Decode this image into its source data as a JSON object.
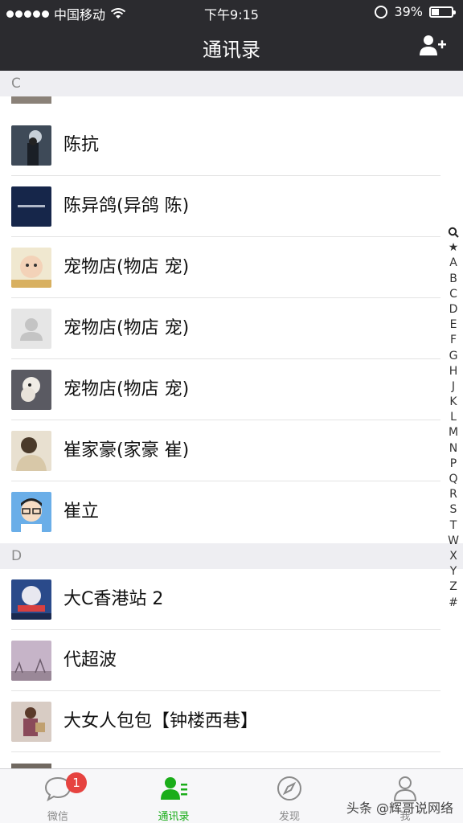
{
  "status_bar": {
    "carrier": "中国移动",
    "time": "下午9:15",
    "battery_percent": "39%",
    "battery_level": 0.39
  },
  "nav": {
    "title": "通讯录",
    "add_icon": "add-contact-icon"
  },
  "sections": [
    {
      "letter": "C",
      "contacts": [
        {
          "name": "陈抗",
          "avatar_color": "#3b4a5a"
        },
        {
          "name": "陈异鸽(异鸽 陈)",
          "avatar_color": "#1a2a4a"
        },
        {
          "name": "宠物店(物店 宠)",
          "avatar_color": "#e8c9a8"
        },
        {
          "name": "宠物店(物店 宠)",
          "avatar_color": "#d9d9d9"
        },
        {
          "name": "宠物店(物店 宠)",
          "avatar_color": "#b89a7a"
        },
        {
          "name": "崔家豪(家豪 崔)",
          "avatar_color": "#c8b89a"
        },
        {
          "name": "崔立",
          "avatar_color": "#5aa0e0"
        }
      ]
    },
    {
      "letter": "D",
      "contacts": [
        {
          "name": "大C香港站 2",
          "avatar_color": "#3a6ab0"
        },
        {
          "name": "代超波",
          "avatar_color": "#b8a8b8"
        },
        {
          "name": "大女人包包【钟楼西巷】",
          "avatar_color": "#8a5a6a"
        }
      ]
    }
  ],
  "index_letters": [
    "A",
    "B",
    "C",
    "D",
    "E",
    "F",
    "G",
    "H",
    "J",
    "K",
    "L",
    "M",
    "N",
    "P",
    "Q",
    "R",
    "S",
    "T",
    "W",
    "X",
    "Y",
    "Z",
    "#"
  ],
  "tabs": [
    {
      "label": "微信",
      "icon": "chat-bubble-icon",
      "badge": "1",
      "active": false
    },
    {
      "label": "通讯录",
      "icon": "contacts-icon",
      "active": true
    },
    {
      "label": "发现",
      "icon": "compass-icon",
      "active": false
    },
    {
      "label": "我",
      "icon": "person-icon",
      "active": false
    }
  ],
  "watermark": "头条 @辉哥说网络",
  "colors": {
    "nav_bg": "#2b2b2f",
    "accent_green": "#1aad19",
    "badge_red": "#e64340",
    "section_bg": "#eeeef2"
  }
}
